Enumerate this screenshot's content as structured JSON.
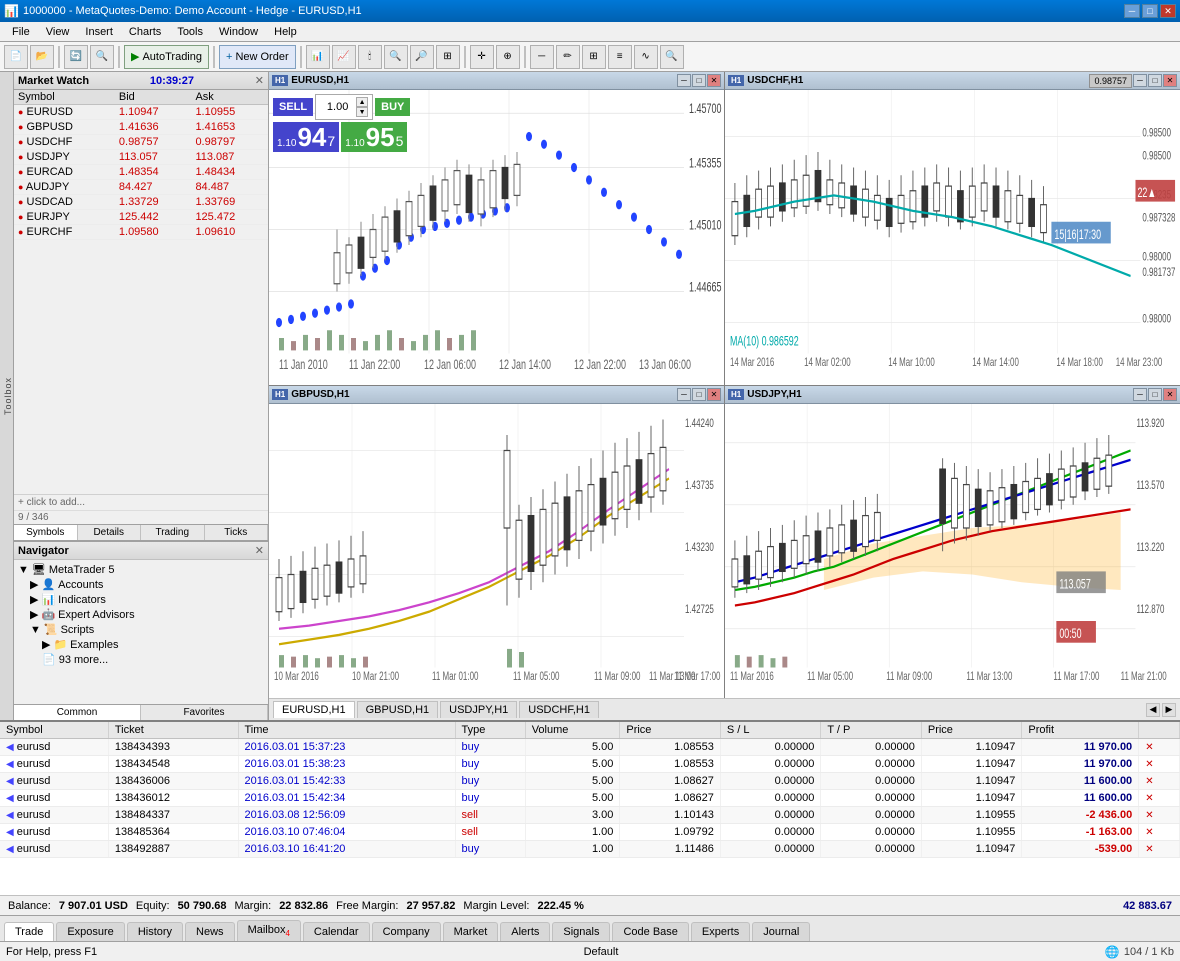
{
  "titlebar": {
    "title": "1000000 - MetaQuotes-Demo: Demo Account - Hedge - EURUSD,H1",
    "min_label": "─",
    "max_label": "□",
    "close_label": "✕"
  },
  "menu": {
    "items": [
      "File",
      "View",
      "Insert",
      "Charts",
      "Tools",
      "Window",
      "Help"
    ]
  },
  "toolbar": {
    "autotrading_label": "AutoTrading",
    "neworder_label": "New Order"
  },
  "market_watch": {
    "title": "Market Watch",
    "time": "10:39:27",
    "symbols": [
      {
        "name": "EURUSD",
        "bid": "1.10947",
        "ask": "1.10955"
      },
      {
        "name": "GBPUSD",
        "bid": "1.41636",
        "ask": "1.41653"
      },
      {
        "name": "USDCHF",
        "bid": "0.98757",
        "ask": "0.98797"
      },
      {
        "name": "USDJPY",
        "bid": "113.057",
        "ask": "113.087"
      },
      {
        "name": "EURCAD",
        "bid": "1.48354",
        "ask": "1.48434"
      },
      {
        "name": "AUDJPY",
        "bid": "84.427",
        "ask": "84.487"
      },
      {
        "name": "USDCAD",
        "bid": "1.33729",
        "ask": "1.33769"
      },
      {
        "name": "EURJPY",
        "bid": "125.442",
        "ask": "125.472"
      },
      {
        "name": "EURCHF",
        "bid": "1.09580",
        "ask": "1.09610"
      }
    ],
    "add_text": "+ click to add...",
    "count": "9 / 346",
    "tabs": [
      "Symbols",
      "Details",
      "Trading",
      "Ticks"
    ]
  },
  "navigator": {
    "title": "Navigator",
    "tree": [
      {
        "label": "MetaTrader 5",
        "level": 0,
        "icon": "📁"
      },
      {
        "label": "Accounts",
        "level": 1,
        "icon": "👤"
      },
      {
        "label": "Indicators",
        "level": 1,
        "icon": "📊"
      },
      {
        "label": "Expert Advisors",
        "level": 1,
        "icon": "🤖"
      },
      {
        "label": "Scripts",
        "level": 1,
        "icon": "📜"
      },
      {
        "label": "Examples",
        "level": 2,
        "icon": "📁"
      },
      {
        "label": "93 more...",
        "level": 2,
        "icon": "📄"
      }
    ],
    "tabs": [
      "Common",
      "Favorites"
    ]
  },
  "charts": {
    "tabs": [
      "EURUSD,H1",
      "GBPUSD,H1",
      "USDJPY,H1",
      "USDCHF,H1"
    ]
  },
  "eurusd_chart": {
    "title": "EURUSD,H1",
    "sell_label": "SELL",
    "buy_label": "BUY",
    "lot_value": "1.00",
    "sell_price": "1.10",
    "sell_price_big": "94",
    "sell_price_sup": "7",
    "buy_price": "1.10",
    "buy_price_big": "95",
    "buy_price_sup": "5"
  },
  "gbpusd_chart": {
    "title": "GBPUSD,H1"
  },
  "usdchf_chart": {
    "title": "USDCHF,H1",
    "ma_label": "MA(10) 0.986592"
  },
  "usdjpy_chart": {
    "title": "USDJPY,H1"
  },
  "orders": {
    "columns": [
      "Symbol",
      "Ticket",
      "Time",
      "Type",
      "Volume",
      "Price",
      "S / L",
      "T / P",
      "Price",
      "Profit"
    ],
    "rows": [
      {
        "icon": "◀",
        "symbol": "eurusd",
        "ticket": "138434393",
        "time": "2016.03.01 15:37:23",
        "type": "buy",
        "volume": "5.00",
        "open_price": "1.08553",
        "sl": "0.00000",
        "tp": "0.00000",
        "price": "1.10947",
        "profit": "11 970.00"
      },
      {
        "icon": "◀",
        "symbol": "eurusd",
        "ticket": "138434548",
        "time": "2016.03.01 15:38:23",
        "type": "buy",
        "volume": "5.00",
        "open_price": "1.08553",
        "sl": "0.00000",
        "tp": "0.00000",
        "price": "1.10947",
        "profit": "11 970.00"
      },
      {
        "icon": "◀",
        "symbol": "eurusd",
        "ticket": "138436006",
        "time": "2016.03.01 15:42:33",
        "type": "buy",
        "volume": "5.00",
        "open_price": "1.08627",
        "sl": "0.00000",
        "tp": "0.00000",
        "price": "1.10947",
        "profit": "11 600.00"
      },
      {
        "icon": "◀",
        "symbol": "eurusd",
        "ticket": "138436012",
        "time": "2016.03.01 15:42:34",
        "type": "buy",
        "volume": "5.00",
        "open_price": "1.08627",
        "sl": "0.00000",
        "tp": "0.00000",
        "price": "1.10947",
        "profit": "11 600.00"
      },
      {
        "icon": "◀",
        "symbol": "eurusd",
        "ticket": "138484337",
        "time": "2016.03.08 12:56:09",
        "type": "sell",
        "volume": "3.00",
        "open_price": "1.10143",
        "sl": "0.00000",
        "tp": "0.00000",
        "price": "1.10955",
        "profit": "-2 436.00"
      },
      {
        "icon": "◀",
        "symbol": "eurusd",
        "ticket": "138485364",
        "time": "2016.03.10 07:46:04",
        "type": "sell",
        "volume": "1.00",
        "open_price": "1.09792",
        "sl": "0.00000",
        "tp": "0.00000",
        "price": "1.10955",
        "profit": "-1 163.00"
      },
      {
        "icon": "◀",
        "symbol": "eurusd",
        "ticket": "138492887",
        "time": "2016.03.10 16:41:20",
        "type": "buy",
        "volume": "1.00",
        "open_price": "1.11486",
        "sl": "0.00000",
        "tp": "0.00000",
        "price": "1.10947",
        "profit": "-539.00"
      }
    ]
  },
  "balance_bar": {
    "balance_label": "Balance:",
    "balance_value": "7 907.01 USD",
    "equity_label": "Equity:",
    "equity_value": "50 790.68",
    "margin_label": "Margin:",
    "margin_value": "22 832.86",
    "free_margin_label": "Free Margin:",
    "free_margin_value": "27 957.82",
    "margin_level_label": "Margin Level:",
    "margin_level_value": "222.45 %",
    "total_profit": "42 883.67"
  },
  "bottom_tabs": {
    "tabs": [
      "Trade",
      "Exposure",
      "History",
      "News",
      "Mailbox",
      "Calendar",
      "Company",
      "Market",
      "Alerts",
      "Signals",
      "Code Base",
      "Experts",
      "Journal"
    ]
  },
  "status_bar": {
    "left_text": "For Help, press F1",
    "center_text": "Default",
    "right_text": "104 / 1 Kb"
  }
}
